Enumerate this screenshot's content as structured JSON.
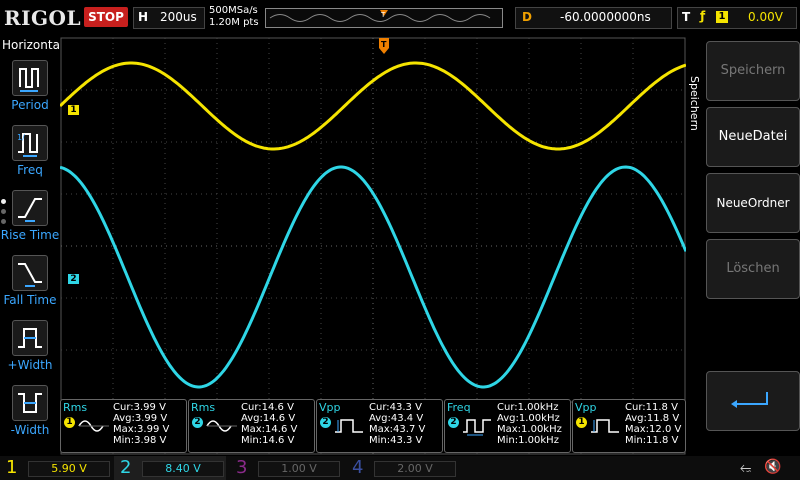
{
  "brand": "RIGOL",
  "run_state": "STOP",
  "horizontal": {
    "key": "H",
    "value": "200us"
  },
  "sample_rate": "500MSa/s",
  "memory_depth": "1.20M pts",
  "delay": {
    "key": "D",
    "value": "-60.0000000ns"
  },
  "trigger": {
    "key": "T",
    "source": "1",
    "level": "0.00V"
  },
  "left_menu": {
    "title": "Horizontal",
    "items": [
      {
        "label": "Period",
        "icon": "period-icon"
      },
      {
        "label": "Freq",
        "icon": "freq-icon"
      },
      {
        "label": "Rise Time",
        "icon": "rise-time-icon"
      },
      {
        "label": "Fall Time",
        "icon": "fall-time-icon"
      },
      {
        "label": "+Width",
        "icon": "pos-width-icon"
      },
      {
        "label": "-Width",
        "icon": "neg-width-icon"
      }
    ]
  },
  "right_menu": {
    "title": "Speichern",
    "items": [
      {
        "label": "Speichern",
        "enabled": false
      },
      {
        "label": "NeueDatei",
        "enabled": true
      },
      {
        "label": "NeueOrdner",
        "enabled": true
      },
      {
        "label": "Löschen",
        "enabled": false
      }
    ],
    "return_icon": "return-arrow-icon"
  },
  "channel_markers": [
    {
      "label": "1",
      "color": "#f5e400"
    },
    {
      "label": "2",
      "color": "#2fd6e6"
    }
  ],
  "measurements": [
    {
      "name": "Rms",
      "channel": "1",
      "channel_color": "#f5e400",
      "rows": [
        "Cur:3.99 V",
        "Avg:3.99 V",
        "Max:3.99 V",
        "Min:3.98 V"
      ],
      "icon": "sine-icon"
    },
    {
      "name": "Rms",
      "channel": "2",
      "channel_color": "#2fd6e6",
      "rows": [
        "Cur:14.6 V",
        "Avg:14.6 V",
        "Max:14.6 V",
        "Min:14.6 V"
      ],
      "icon": "sine-icon"
    },
    {
      "name": "Vpp",
      "channel": "2",
      "channel_color": "#2fd6e6",
      "rows": [
        "Cur:43.3 V",
        "Avg:43.4 V",
        "Max:43.7 V",
        "Min:43.3 V"
      ],
      "icon": "pulse-vpp-icon"
    },
    {
      "name": "Freq",
      "channel": "2",
      "channel_color": "#2fd6e6",
      "rows": [
        "Cur:1.00kHz",
        "Avg:1.00kHz",
        "Max:1.00kHz",
        "Min:1.00kHz"
      ],
      "icon": "pulse-freq-icon"
    },
    {
      "name": "Vpp",
      "channel": "1",
      "channel_color": "#f5e400",
      "rows": [
        "Cur:11.8 V",
        "Avg:11.8 V",
        "Max:12.0 V",
        "Min:11.8 V"
      ],
      "icon": "pulse-vpp-icon"
    }
  ],
  "channels": [
    {
      "num": "1",
      "scale": "5.90 V",
      "active": true,
      "color": "#f5e400"
    },
    {
      "num": "2",
      "scale": "8.40 V",
      "active": true,
      "color": "#2fd6e6"
    },
    {
      "num": "3",
      "scale": "1.00 V",
      "active": false,
      "color": "#c040c0"
    },
    {
      "num": "4",
      "scale": "2.00 V",
      "active": false,
      "color": "#4060d0"
    }
  ],
  "status_icons": [
    "usb-icon",
    "speaker-muted-icon"
  ],
  "waveforms": {
    "ch1": {
      "shape": "sine",
      "cycles_on_screen": 2.2,
      "color": "#f5e400"
    },
    "ch2": {
      "shape": "sine",
      "cycles_on_screen": 2.2,
      "color": "#2fd6e6"
    }
  }
}
